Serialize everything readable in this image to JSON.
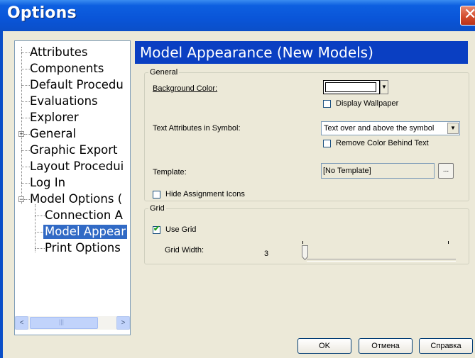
{
  "window": {
    "title": "Options"
  },
  "tree": {
    "items": [
      {
        "label": "Attributes"
      },
      {
        "label": "Components"
      },
      {
        "label": "Default Procedu"
      },
      {
        "label": "Evaluations"
      },
      {
        "label": "Explorer"
      },
      {
        "label": "General",
        "expander": "+"
      },
      {
        "label": "Graphic Export"
      },
      {
        "label": "Layout Procedui"
      },
      {
        "label": "Log In"
      },
      {
        "label": "Model Options (",
        "expander": "−"
      },
      {
        "label": "Connection A"
      },
      {
        "label": "Model Appear",
        "selected": true
      },
      {
        "label": "Print Options"
      }
    ],
    "scroll_thumb_glyph": "|||"
  },
  "panel": {
    "header": "Model Appearance (New Models)",
    "general": {
      "legend": "General",
      "background_color_label": "Background Color:",
      "display_wallpaper_label": "Display Wallpaper",
      "text_attributes_label": "Text Attributes in Symbol:",
      "text_attributes_value": "Text over and above the symbol",
      "remove_color_label": "Remove Color Behind Text",
      "template_label": "Template:",
      "template_value": "[No Template]",
      "browse_label": "...",
      "hide_assignment_label": "Hide Assignment Icons"
    },
    "grid": {
      "legend": "Grid",
      "use_grid_label": "Use Grid",
      "use_grid_checked": true,
      "grid_width_label": "Grid Width:",
      "grid_width_value": "3"
    }
  },
  "buttons": {
    "ok": "OK",
    "cancel": "Отмена",
    "help": "Справка"
  }
}
